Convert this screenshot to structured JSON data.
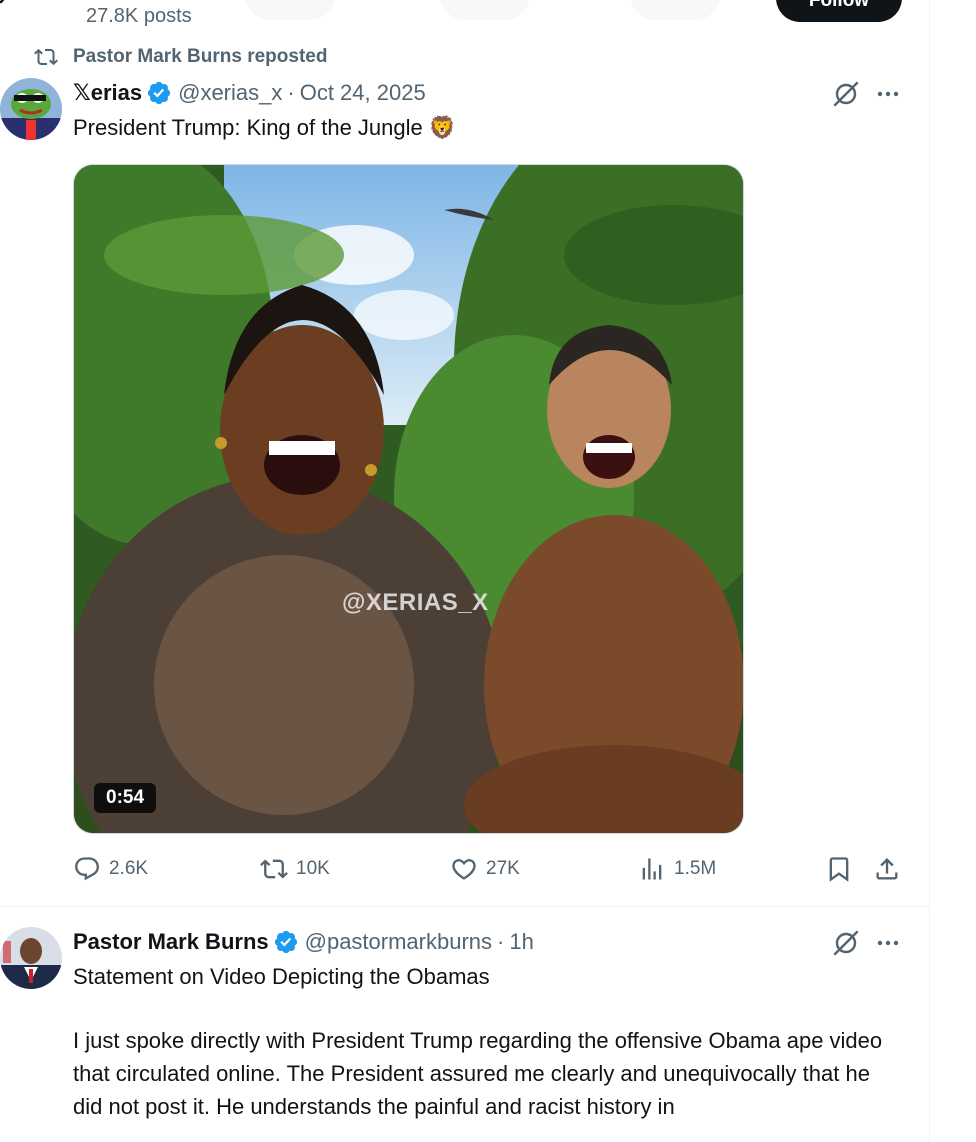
{
  "header": {
    "posts_count": "27.8K posts",
    "follow_label": "Follow"
  },
  "repost": {
    "text": "Pastor Mark Burns reposted"
  },
  "tweet1": {
    "name": "𝕏erias",
    "handle": "@xerias_x",
    "separator": "·",
    "time": "Oct 24, 2025",
    "text": "President Trump: King of the Jungle 🦁",
    "media": {
      "watermark": "@XERIAS_X",
      "duration": "0:54"
    },
    "actions": {
      "replies": "2.6K",
      "reposts": "10K",
      "likes": "27K",
      "views": "1.5M"
    }
  },
  "tweet2": {
    "name": "Pastor Mark Burns",
    "handle": "@pastormarkburns",
    "separator": "·",
    "time": "1h",
    "title_line": "Statement on Video Depicting the Obamas",
    "body": "I just spoke directly with President Trump regarding the offensive Obama ape video that circulated online. The President assured me clearly and unequivocally that he did not post it. He understands the painful and racist history in"
  },
  "icons": {
    "verified": "verified-badge-icon",
    "grok": "grok-icon",
    "more": "more-icon",
    "reply": "reply-icon",
    "repost": "repost-icon",
    "like": "heart-icon",
    "views": "views-icon",
    "bookmark": "bookmark-icon",
    "share": "share-icon"
  },
  "colors": {
    "verified": "#1d9bf0",
    "secondary_text": "#536471",
    "primary_text": "#0f1419"
  }
}
